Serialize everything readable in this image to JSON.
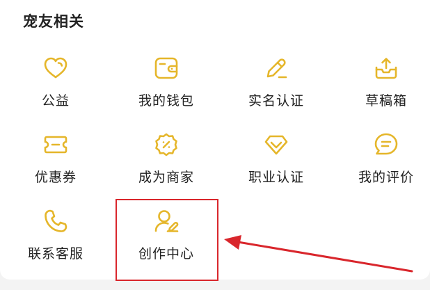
{
  "section": {
    "title": "宠友相关"
  },
  "theme": {
    "icon_color": "#e5b62a",
    "annotation_color": "#d9262c"
  },
  "items": [
    {
      "label": "公益",
      "icon": "heart-icon"
    },
    {
      "label": "我的钱包",
      "icon": "wallet-icon"
    },
    {
      "label": "实名认证",
      "icon": "pencil-icon"
    },
    {
      "label": "草稿箱",
      "icon": "inbox-upload-icon"
    },
    {
      "label": "优惠券",
      "icon": "coupon-icon"
    },
    {
      "label": "成为商家",
      "icon": "discount-badge-icon"
    },
    {
      "label": "职业认证",
      "icon": "diamond-icon"
    },
    {
      "label": "我的评价",
      "icon": "comment-icon"
    },
    {
      "label": "联系客服",
      "icon": "phone-icon"
    },
    {
      "label": "创作中心",
      "icon": "user-edit-icon"
    }
  ]
}
